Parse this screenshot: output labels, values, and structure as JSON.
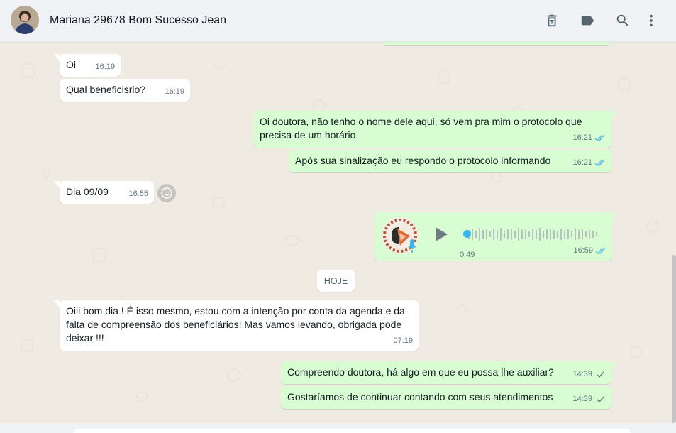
{
  "header": {
    "title": "Mariana 29678 Bom Sucesso Jean",
    "icons": [
      "delete-icon",
      "label-icon",
      "search-icon",
      "menu-icon"
    ]
  },
  "messages": [
    {
      "id": "m1",
      "direction": "in",
      "text": "Oi",
      "time": "16:19"
    },
    {
      "id": "m2",
      "direction": "in",
      "text": "Qual beneficisrio?",
      "time": "16:19"
    },
    {
      "id": "m3",
      "direction": "out",
      "text_line1": "Oi doutora, não tenho o nome dele aqui, só vem pra mim o protocolo que",
      "text_line2": "precisa de um horário",
      "time": "16:21",
      "status": "read"
    },
    {
      "id": "m4",
      "direction": "out",
      "text": "Após sua sinalização eu respondo o protocolo informando",
      "time": "16:21",
      "status": "read"
    },
    {
      "id": "m5",
      "direction": "in",
      "text": "Dia 09/09",
      "time": "16:55"
    },
    {
      "id": "m6",
      "direction": "out",
      "type": "voice",
      "duration": "0:49",
      "time": "16:59",
      "status": "read",
      "progress": 0
    },
    {
      "id": "m7",
      "direction": "in",
      "text_line1": "Oiii bom dia ! É isso mesmo, estou com a intenção por conta da agenda e da",
      "text_line2": "falta de compreensão dos beneficiários! Mas vamos levando, obrigada pode",
      "text_line3": "deixar !!!",
      "time": "07:19"
    },
    {
      "id": "m8",
      "direction": "out",
      "text": "Compreendo doutora, há algo em que eu possa lhe auxiliar?",
      "time": "14:39",
      "status": "sent"
    },
    {
      "id": "m9",
      "direction": "out",
      "text": "Gostaríamos de continuar contando com seus atendimentos",
      "time": "14:39",
      "status": "sent"
    }
  ],
  "date_divider": "HOJE",
  "colors": {
    "incoming": "#ffffff",
    "outgoing": "#d9fdd3",
    "read_tick": "#53bdeb",
    "sent_tick": "#667781",
    "chat_bg": "#efeae2"
  }
}
